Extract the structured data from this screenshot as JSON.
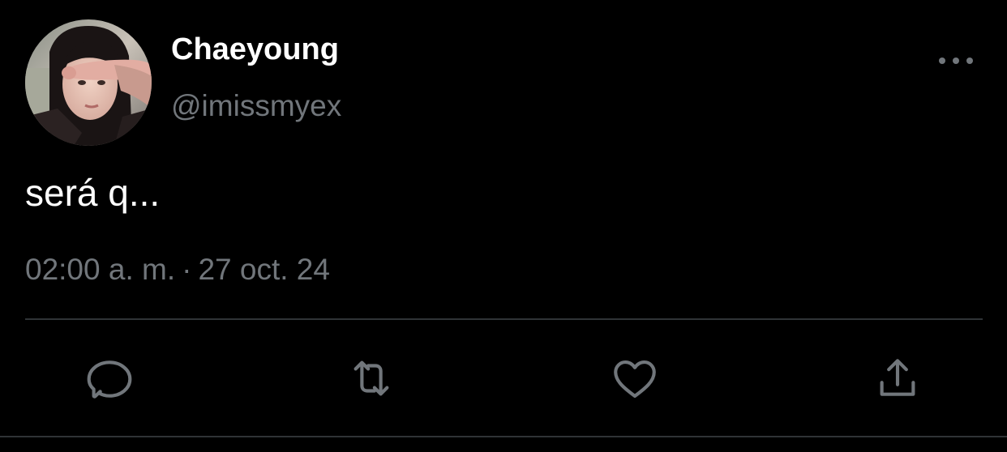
{
  "tweet": {
    "author_name": "Chaeyoung",
    "author_handle": "@imissmyex",
    "text": "será q...",
    "time": "02:00 a. m.",
    "separator": "·",
    "date": "27 oct. 24"
  },
  "actions": [
    {
      "name": "reply",
      "icon": "reply-icon"
    },
    {
      "name": "retweet",
      "icon": "retweet-icon"
    },
    {
      "name": "like",
      "icon": "heart-icon"
    },
    {
      "name": "share",
      "icon": "share-icon"
    }
  ],
  "menu": {
    "icon": "more-dots-icon"
  },
  "colors": {
    "background": "#000000",
    "name": "#ffffff",
    "secondary": "#71767b",
    "divider": "#2f3336"
  }
}
